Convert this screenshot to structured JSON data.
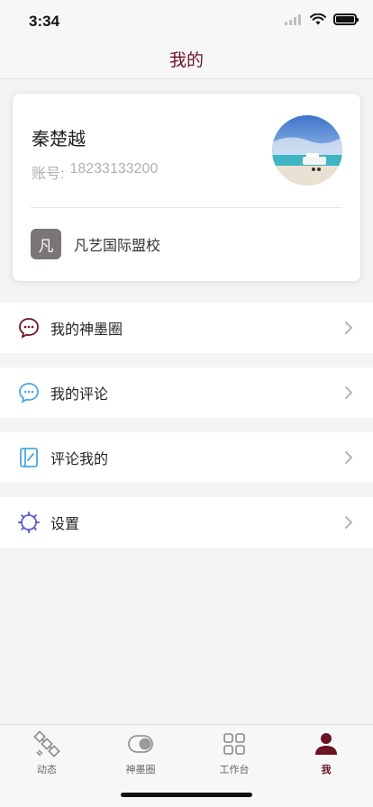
{
  "status": {
    "time": "3:34"
  },
  "nav": {
    "title": "我的"
  },
  "profile": {
    "name": "秦楚越",
    "account_label": "账号:",
    "account_value": "18233133200",
    "school_badge": "凡",
    "school_name": "凡艺国际盟校"
  },
  "menu": [
    {
      "label": "我的神墨圈",
      "icon": "chat-bubble-dots-icon"
    },
    {
      "label": "我的评论",
      "icon": "comment-bubble-icon"
    },
    {
      "label": "评论我的",
      "icon": "notebook-icon"
    },
    {
      "label": "设置",
      "icon": "gear-icon"
    }
  ],
  "tabs": [
    {
      "label": "动态",
      "icon": "satellite-icon"
    },
    {
      "label": "神墨圈",
      "icon": "toggle-icon"
    },
    {
      "label": "工作台",
      "icon": "grid-icon"
    },
    {
      "label": "我",
      "icon": "person-icon"
    }
  ],
  "colors": {
    "brand": "#6b1424",
    "accent_blue": "#4aa8e0",
    "settings_purple": "#5a5fd0"
  }
}
